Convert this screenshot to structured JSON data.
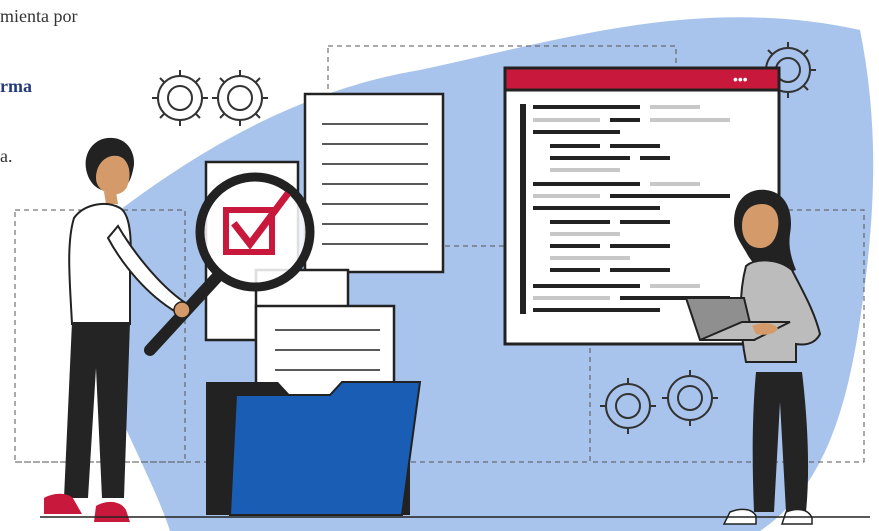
{
  "intro_text": {
    "line1": "mienta por",
    "line2": "rma",
    "line3": "a."
  },
  "browser_window": {
    "dots": "•••"
  },
  "colors": {
    "blob": "#a9c4ec",
    "navy": "#263a7a",
    "folder_blue": "#1a5db5",
    "red": "#c8193c",
    "skin": "#d49a6a",
    "hair": "#2a2a2a",
    "shirt": "#ffffff",
    "sweater": "#bcbcbc",
    "pants": "#242424",
    "shoe": "#c8193c",
    "laptop": "#8f8f8f"
  },
  "icons": [
    "gear-icon",
    "document-icon",
    "magnifier-icon",
    "checkbox-icon",
    "folder-icon",
    "code-window-icon"
  ]
}
